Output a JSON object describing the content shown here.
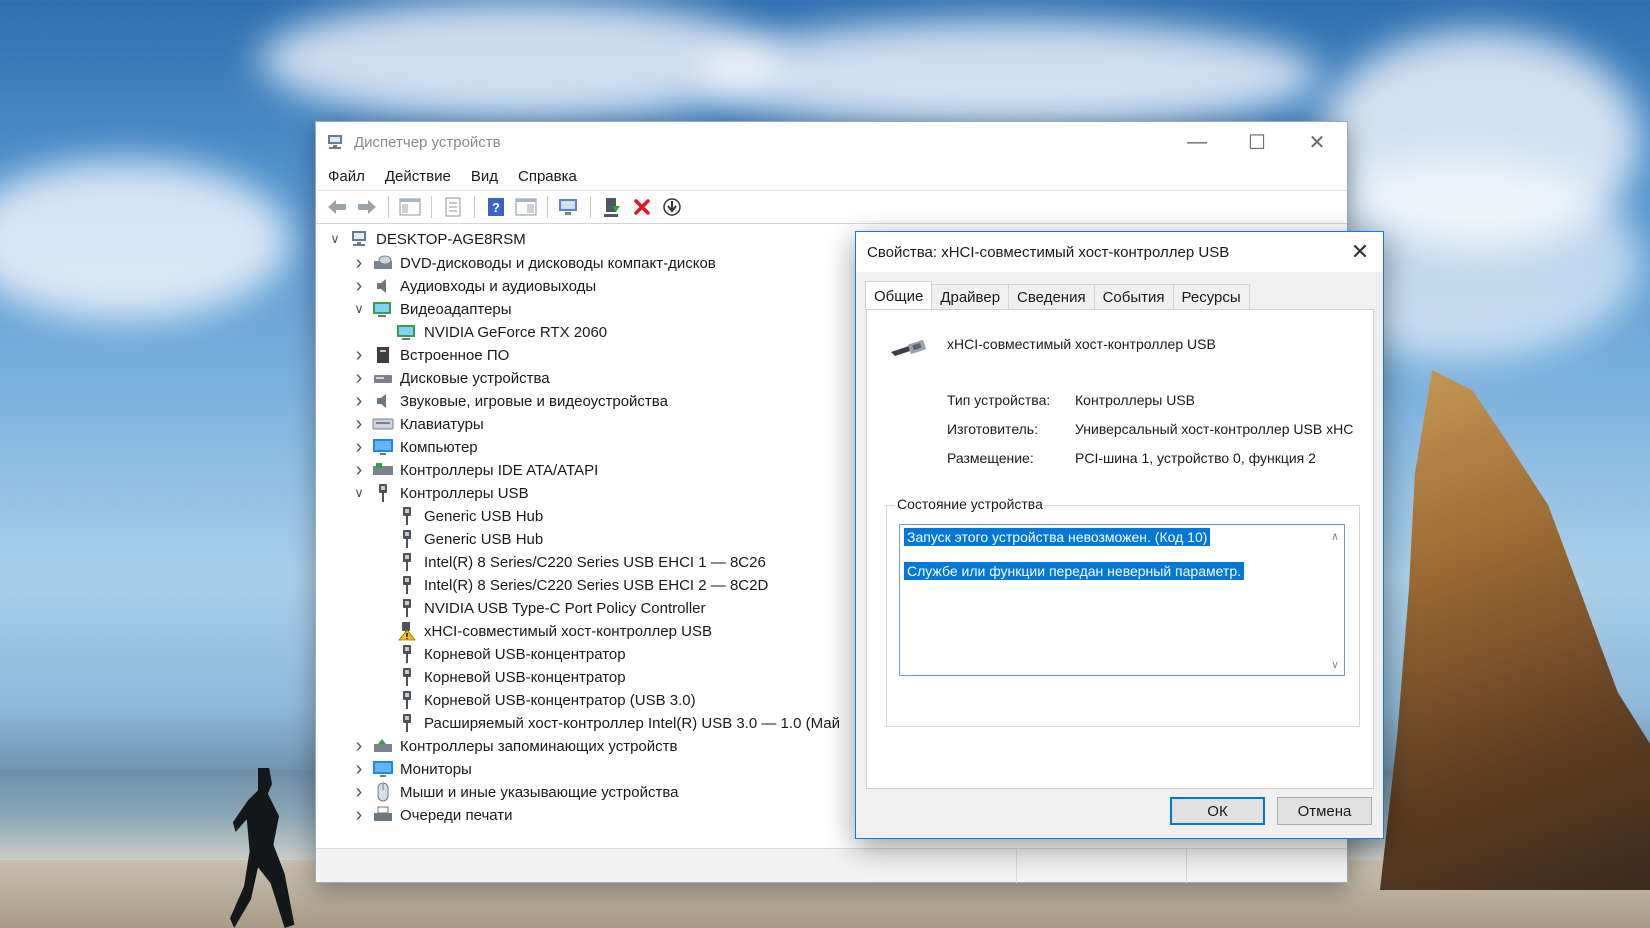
{
  "window": {
    "title": "Диспетчер устройств",
    "minimize_glyph": "—",
    "maximize_glyph": "☐",
    "close_glyph": "✕"
  },
  "menu": [
    "Файл",
    "Действие",
    "Вид",
    "Справка"
  ],
  "toolbar": {
    "buttons": [
      "back-arrow-icon",
      "forward-arrow-icon",
      "show-hide-console-tree-icon",
      "properties-sheet-icon",
      "help-icon",
      "show-view-icon",
      "scan-hardware-icon",
      "update-driver-icon",
      "uninstall-device-icon",
      "disable-device-icon"
    ]
  },
  "tree": {
    "root": "DESKTOP-AGE8RSM",
    "items": [
      {
        "label": "DVD-дисководы и дисководы компакт-дисков",
        "level": 1,
        "expand": "collapsed",
        "icon": "dvd-drive-icon"
      },
      {
        "label": "Аудиовходы и аудиовыходы",
        "level": 1,
        "expand": "collapsed",
        "icon": "speaker-icon"
      },
      {
        "label": "Видеоадаптеры",
        "level": 1,
        "expand": "expanded",
        "icon": "display-adapter-icon"
      },
      {
        "label": "NVIDIA GeForce RTX 2060",
        "level": 2,
        "expand": "none",
        "icon": "display-adapter-icon"
      },
      {
        "label": "Встроенное ПО",
        "level": 1,
        "expand": "collapsed",
        "icon": "firmware-icon"
      },
      {
        "label": "Дисковые устройства",
        "level": 1,
        "expand": "collapsed",
        "icon": "disk-drive-icon"
      },
      {
        "label": "Звуковые, игровые и видеоустройства",
        "level": 1,
        "expand": "collapsed",
        "icon": "speaker-icon"
      },
      {
        "label": "Клавиатуры",
        "level": 1,
        "expand": "collapsed",
        "icon": "keyboard-icon"
      },
      {
        "label": "Компьютер",
        "level": 1,
        "expand": "collapsed",
        "icon": "monitor-icon"
      },
      {
        "label": "Контроллеры IDE ATA/ATAPI",
        "level": 1,
        "expand": "collapsed",
        "icon": "ide-controller-icon"
      },
      {
        "label": "Контроллеры USB",
        "level": 1,
        "expand": "expanded",
        "icon": "usb-plug-icon"
      },
      {
        "label": "Generic USB Hub",
        "level": 2,
        "expand": "none",
        "icon": "usb-plug-icon"
      },
      {
        "label": "Generic USB Hub",
        "level": 2,
        "expand": "none",
        "icon": "usb-plug-icon"
      },
      {
        "label": "Intel(R) 8 Series/C220 Series USB EHCI 1 — 8C26",
        "level": 2,
        "expand": "none",
        "icon": "usb-plug-icon"
      },
      {
        "label": "Intel(R) 8 Series/C220 Series USB EHCI 2 — 8C2D",
        "level": 2,
        "expand": "none",
        "icon": "usb-plug-icon"
      },
      {
        "label": "NVIDIA USB Type-C Port Policy Controller",
        "level": 2,
        "expand": "none",
        "icon": "usb-plug-icon"
      },
      {
        "label": "xHCI-совместимый хост-контроллер USB",
        "level": 2,
        "expand": "none",
        "icon": "warning-usb-icon"
      },
      {
        "label": "Корневой USB-концентратор",
        "level": 2,
        "expand": "none",
        "icon": "usb-plug-icon"
      },
      {
        "label": "Корневой USB-концентратор",
        "level": 2,
        "expand": "none",
        "icon": "usb-plug-icon"
      },
      {
        "label": "Корневой USB-концентратор (USB 3.0)",
        "level": 2,
        "expand": "none",
        "icon": "usb-plug-icon"
      },
      {
        "label": "Расширяемый хост-контроллер Intel(R) USB 3.0 — 1.0 (Май",
        "level": 2,
        "expand": "none",
        "icon": "usb-plug-icon"
      },
      {
        "label": "Контроллеры запоминающих устройств",
        "level": 1,
        "expand": "collapsed",
        "icon": "storage-controller-icon"
      },
      {
        "label": "Мониторы",
        "level": 1,
        "expand": "collapsed",
        "icon": "monitor-icon"
      },
      {
        "label": "Мыши и иные указывающие устройства",
        "level": 1,
        "expand": "collapsed",
        "icon": "mouse-icon"
      },
      {
        "label": "Очереди печати",
        "level": 1,
        "expand": "collapsed",
        "icon": "printer-icon"
      }
    ]
  },
  "dialog": {
    "title": "Свойства: xHCI-совместимый хост-контроллер USB",
    "close_glyph": "✕",
    "tabs": [
      "Общие",
      "Драйвер",
      "Сведения",
      "События",
      "Ресурсы"
    ],
    "active_tab": "Общие",
    "device_name": "xHCI-совместимый хост-контроллер USB",
    "properties": [
      {
        "label": "Тип устройства:",
        "value": "Контроллеры USB"
      },
      {
        "label": "Изготовитель:",
        "value": "Универсальный хост-контроллер USB xHC"
      },
      {
        "label": "Размещение:",
        "value": "PCI-шина 1, устройство 0, функция 2"
      }
    ],
    "status_group_label": "Состояние устройства",
    "status_lines": [
      "Запуск этого устройства невозможен. (Код 10)",
      "Службе или функции передан неверный параметр."
    ],
    "ok_label": "ОК",
    "cancel_label": "Отмена"
  },
  "colors": {
    "selection": "#0078d7",
    "dialog_border": "#1a79d6",
    "warning": "#f5c400",
    "uninstall_red": "#e81123"
  }
}
